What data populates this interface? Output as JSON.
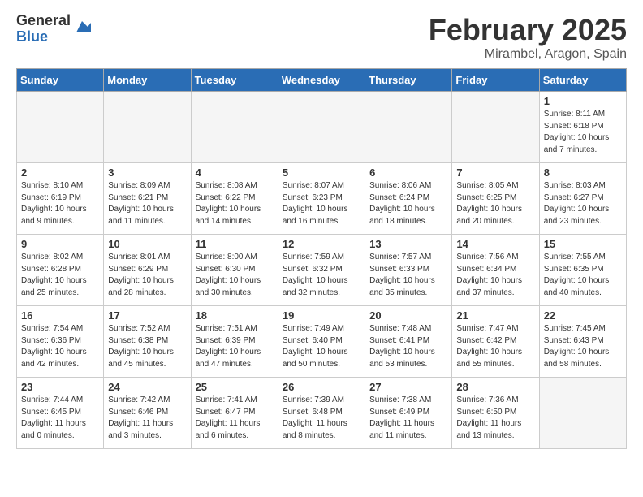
{
  "header": {
    "logo_general": "General",
    "logo_blue": "Blue",
    "title": "February 2025",
    "subtitle": "Mirambel, Aragon, Spain"
  },
  "days_of_week": [
    "Sunday",
    "Monday",
    "Tuesday",
    "Wednesday",
    "Thursday",
    "Friday",
    "Saturday"
  ],
  "weeks": [
    [
      {
        "day": "",
        "info": ""
      },
      {
        "day": "",
        "info": ""
      },
      {
        "day": "",
        "info": ""
      },
      {
        "day": "",
        "info": ""
      },
      {
        "day": "",
        "info": ""
      },
      {
        "day": "",
        "info": ""
      },
      {
        "day": "1",
        "info": "Sunrise: 8:11 AM\nSunset: 6:18 PM\nDaylight: 10 hours\nand 7 minutes."
      }
    ],
    [
      {
        "day": "2",
        "info": "Sunrise: 8:10 AM\nSunset: 6:19 PM\nDaylight: 10 hours\nand 9 minutes."
      },
      {
        "day": "3",
        "info": "Sunrise: 8:09 AM\nSunset: 6:21 PM\nDaylight: 10 hours\nand 11 minutes."
      },
      {
        "day": "4",
        "info": "Sunrise: 8:08 AM\nSunset: 6:22 PM\nDaylight: 10 hours\nand 14 minutes."
      },
      {
        "day": "5",
        "info": "Sunrise: 8:07 AM\nSunset: 6:23 PM\nDaylight: 10 hours\nand 16 minutes."
      },
      {
        "day": "6",
        "info": "Sunrise: 8:06 AM\nSunset: 6:24 PM\nDaylight: 10 hours\nand 18 minutes."
      },
      {
        "day": "7",
        "info": "Sunrise: 8:05 AM\nSunset: 6:25 PM\nDaylight: 10 hours\nand 20 minutes."
      },
      {
        "day": "8",
        "info": "Sunrise: 8:03 AM\nSunset: 6:27 PM\nDaylight: 10 hours\nand 23 minutes."
      }
    ],
    [
      {
        "day": "9",
        "info": "Sunrise: 8:02 AM\nSunset: 6:28 PM\nDaylight: 10 hours\nand 25 minutes."
      },
      {
        "day": "10",
        "info": "Sunrise: 8:01 AM\nSunset: 6:29 PM\nDaylight: 10 hours\nand 28 minutes."
      },
      {
        "day": "11",
        "info": "Sunrise: 8:00 AM\nSunset: 6:30 PM\nDaylight: 10 hours\nand 30 minutes."
      },
      {
        "day": "12",
        "info": "Sunrise: 7:59 AM\nSunset: 6:32 PM\nDaylight: 10 hours\nand 32 minutes."
      },
      {
        "day": "13",
        "info": "Sunrise: 7:57 AM\nSunset: 6:33 PM\nDaylight: 10 hours\nand 35 minutes."
      },
      {
        "day": "14",
        "info": "Sunrise: 7:56 AM\nSunset: 6:34 PM\nDaylight: 10 hours\nand 37 minutes."
      },
      {
        "day": "15",
        "info": "Sunrise: 7:55 AM\nSunset: 6:35 PM\nDaylight: 10 hours\nand 40 minutes."
      }
    ],
    [
      {
        "day": "16",
        "info": "Sunrise: 7:54 AM\nSunset: 6:36 PM\nDaylight: 10 hours\nand 42 minutes."
      },
      {
        "day": "17",
        "info": "Sunrise: 7:52 AM\nSunset: 6:38 PM\nDaylight: 10 hours\nand 45 minutes."
      },
      {
        "day": "18",
        "info": "Sunrise: 7:51 AM\nSunset: 6:39 PM\nDaylight: 10 hours\nand 47 minutes."
      },
      {
        "day": "19",
        "info": "Sunrise: 7:49 AM\nSunset: 6:40 PM\nDaylight: 10 hours\nand 50 minutes."
      },
      {
        "day": "20",
        "info": "Sunrise: 7:48 AM\nSunset: 6:41 PM\nDaylight: 10 hours\nand 53 minutes."
      },
      {
        "day": "21",
        "info": "Sunrise: 7:47 AM\nSunset: 6:42 PM\nDaylight: 10 hours\nand 55 minutes."
      },
      {
        "day": "22",
        "info": "Sunrise: 7:45 AM\nSunset: 6:43 PM\nDaylight: 10 hours\nand 58 minutes."
      }
    ],
    [
      {
        "day": "23",
        "info": "Sunrise: 7:44 AM\nSunset: 6:45 PM\nDaylight: 11 hours\nand 0 minutes."
      },
      {
        "day": "24",
        "info": "Sunrise: 7:42 AM\nSunset: 6:46 PM\nDaylight: 11 hours\nand 3 minutes."
      },
      {
        "day": "25",
        "info": "Sunrise: 7:41 AM\nSunset: 6:47 PM\nDaylight: 11 hours\nand 6 minutes."
      },
      {
        "day": "26",
        "info": "Sunrise: 7:39 AM\nSunset: 6:48 PM\nDaylight: 11 hours\nand 8 minutes."
      },
      {
        "day": "27",
        "info": "Sunrise: 7:38 AM\nSunset: 6:49 PM\nDaylight: 11 hours\nand 11 minutes."
      },
      {
        "day": "28",
        "info": "Sunrise: 7:36 AM\nSunset: 6:50 PM\nDaylight: 11 hours\nand 13 minutes."
      },
      {
        "day": "",
        "info": ""
      }
    ]
  ]
}
